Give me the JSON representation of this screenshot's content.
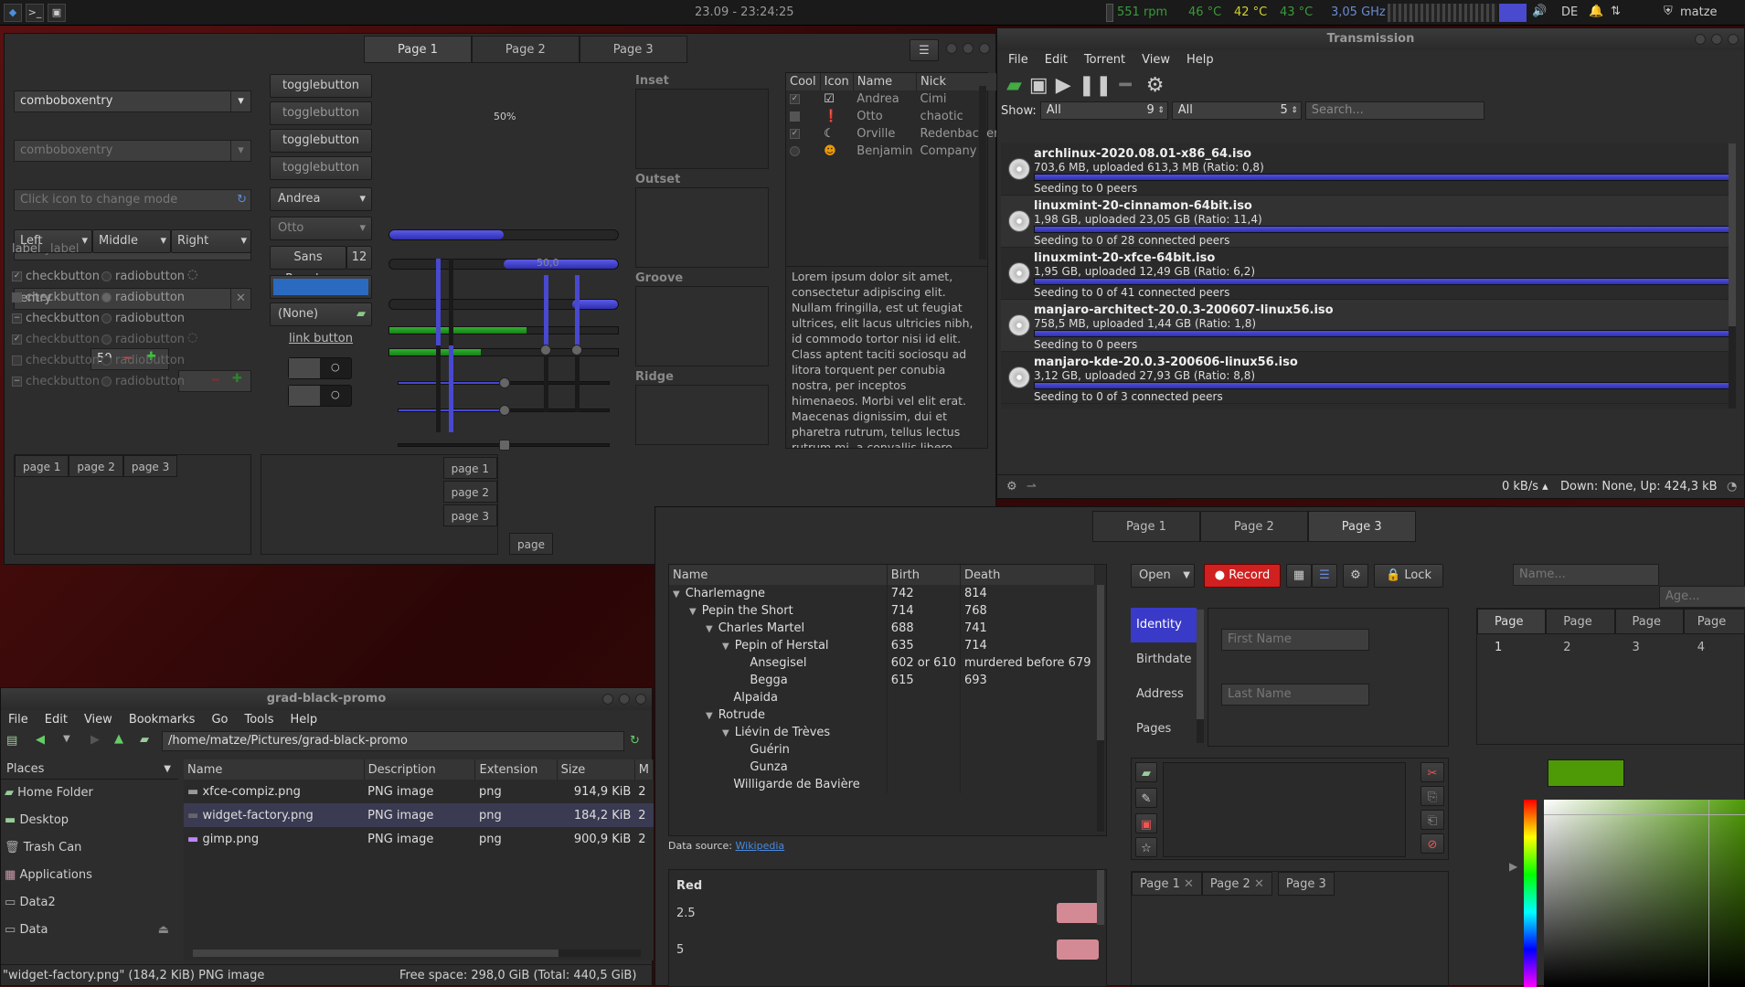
{
  "topbar": {
    "datetime": "23.09 - 23:24:25",
    "rpm": "551 rpm",
    "t1": "46 °C",
    "t2": "42 °C",
    "t3": "43 °C",
    "ghz": "3,05 GHz",
    "lang": "DE",
    "user": "matze"
  },
  "main": {
    "tabs": [
      "Page 1",
      "Page 2",
      "Page 3"
    ],
    "combo1": "comboboxentry",
    "combo2": "comboboxentry",
    "iconentry": "Click icon to change mode",
    "entry1": "entry",
    "entry2": "entry",
    "lmr": [
      "Left",
      "Middle",
      "Right"
    ],
    "label1": "label",
    "label2": "label",
    "spin": "50",
    "checks": [
      "checkbutton",
      "checkbutton",
      "checkbutton",
      "checkbutton",
      "checkbutton",
      "checkbutton"
    ],
    "radios": [
      "radiobutton",
      "radiobutton",
      "radiobutton",
      "radiobutton",
      "radiobutton",
      "radiobutton"
    ],
    "toggles": [
      "togglebutton",
      "togglebutton",
      "togglebutton",
      "togglebutton"
    ],
    "combo_andrea": "Andrea",
    "combo_otto": "Otto",
    "font": "Sans Regular",
    "fontsize": "12",
    "none": "(None)",
    "link": "link button",
    "pct": "50%",
    "vscale": "50,0",
    "frames": [
      "Inset",
      "Outset",
      "Groove",
      "Ridge"
    ],
    "tree_headers": [
      "Cool",
      "Icon",
      "Name",
      "Nick"
    ],
    "tree_rows": [
      {
        "name": "Andrea",
        "nick": "Cimi"
      },
      {
        "name": "Otto",
        "nick": "chaotic"
      },
      {
        "name": "Orville",
        "nick": "Redenbacher"
      },
      {
        "name": "Benjamin",
        "nick": "Company"
      }
    ],
    "lorem": "Lorem ipsum dolor sit amet, consectetur adipiscing elit. Nullam fringilla, est ut feugiat ultrices, elit lacus ultricies nibh, id commodo tortor nisi id elit. Class aptent taciti sociosqu ad litora torquent per conubia nostra, per inceptos himenaeos. Morbi vel elit erat. Maecenas dignissim, dui et pharetra rutrum, tellus lectus rutrum mi, a convallis libero nisi quis tellus.",
    "small_tabs": [
      "page 1",
      "page 2",
      "page 3"
    ],
    "vtabs": [
      "page 1",
      "page 2",
      "page 3"
    ],
    "cut_tab": "page"
  },
  "transmission": {
    "title": "Transmission",
    "menu": [
      "File",
      "Edit",
      "Torrent",
      "View",
      "Help"
    ],
    "show": "Show:",
    "filter1": "All",
    "count1": "9",
    "filter2": "All",
    "count2": "5",
    "search": "Search...",
    "items": [
      {
        "name": "archlinux-2020.08.01-x86_64.iso",
        "stats": "703,6 MB, uploaded 613,3 MB (Ratio: 0,8)",
        "seed": "Seeding to 0 peers",
        "progress": 1.0
      },
      {
        "name": "linuxmint-20-cinnamon-64bit.iso",
        "stats": "1,98 GB, uploaded 23,05 GB (Ratio: 11,4)",
        "seed": "Seeding to 0 of 28 connected peers",
        "progress": 1.0
      },
      {
        "name": "linuxmint-20-xfce-64bit.iso",
        "stats": "1,95 GB, uploaded 12,49 GB (Ratio: 6,2)",
        "seed": "Seeding to 0 of 41 connected peers",
        "progress": 1.0
      },
      {
        "name": "manjaro-architect-20.0.3-200607-linux56.iso",
        "stats": "758,5 MB, uploaded 1,44 GB (Ratio: 1,8)",
        "seed": "Seeding to 0 peers",
        "progress": 1.0
      },
      {
        "name": "manjaro-kde-20.0.3-200606-linux56.iso",
        "stats": "3,12 GB, uploaded 27,93 GB (Ratio: 8,8)",
        "seed": "Seeding to 0 of 3 connected peers",
        "progress": 1.0
      }
    ],
    "speed": "0 kB/s ▴",
    "status": "Down: None, Up: 424,3 kB"
  },
  "fm": {
    "title": "grad-black-promo",
    "menu": [
      "File",
      "Edit",
      "View",
      "Bookmarks",
      "Go",
      "Tools",
      "Help"
    ],
    "path": "/home/matze/Pictures/grad-black-promo",
    "places": "Places",
    "place_items": [
      "Home Folder",
      "Desktop",
      "Trash Can",
      "Applications",
      "Data2",
      "Data"
    ],
    "cols": [
      "Name",
      "Description",
      "Extension",
      "Size",
      "M"
    ],
    "files": [
      {
        "name": "xfce-compiz.png",
        "desc": "PNG image",
        "ext": "png",
        "size": "914,9 KiB",
        "m": "2"
      },
      {
        "name": "widget-factory.png",
        "desc": "PNG image",
        "ext": "png",
        "size": "184,2 KiB",
        "m": "2"
      },
      {
        "name": "gimp.png",
        "desc": "PNG image",
        "ext": "png",
        "size": "900,9 KiB",
        "m": "2"
      }
    ],
    "status_left": "\"widget-factory.png\" (184,2 KiB) PNG image",
    "status_right": "Free space: 298,0 GiB (Total: 440,5 GiB)"
  },
  "wf2": {
    "tabs": [
      "Page 1",
      "Page 2",
      "Page 3"
    ],
    "cols": [
      "Name",
      "Birth",
      "Death"
    ],
    "rows": [
      {
        "n": "Charlemagne",
        "b": "742",
        "d": "814",
        "lvl": 0
      },
      {
        "n": "Pepin the Short",
        "b": "714",
        "d": "768",
        "lvl": 1
      },
      {
        "n": "Charles Martel",
        "b": "688",
        "d": "741",
        "lvl": 2
      },
      {
        "n": "Pepin of Herstal",
        "b": "635",
        "d": "714",
        "lvl": 3
      },
      {
        "n": "Ansegisel",
        "b": "602 or 610",
        "d": "murdered before 679",
        "lvl": 4
      },
      {
        "n": "Begga",
        "b": "615",
        "d": "693",
        "lvl": 4
      },
      {
        "n": "Alpaida",
        "b": "",
        "d": "",
        "lvl": 3
      },
      {
        "n": "Rotrude",
        "b": "",
        "d": "",
        "lvl": 2
      },
      {
        "n": "Liévin de Trèves",
        "b": "",
        "d": "",
        "lvl": 3
      },
      {
        "n": "Guérin",
        "b": "",
        "d": "",
        "lvl": 4
      },
      {
        "n": "Gunza",
        "b": "",
        "d": "",
        "lvl": 4
      },
      {
        "n": "Willigarde de Bavière",
        "b": "",
        "d": "",
        "lvl": 3
      }
    ],
    "datasource": "Data source:",
    "wiki": "Wikipedia",
    "open": "Open",
    "record": "Record",
    "lock": "Lock",
    "stack": [
      "Identity",
      "Birthdate",
      "Address",
      "Pages"
    ],
    "first": "First Name",
    "last": "Last Name",
    "name_ph": "Name...",
    "age_ph": "Age...",
    "ntabs": [
      "Page 1",
      "Page 2",
      "Page 3",
      "Page 4"
    ],
    "ctabs": [
      "Page 1",
      "Page 2",
      "Page 3"
    ],
    "red": "Red",
    "v1": "2.5",
    "v2": "5",
    "hex": "#4E9A06"
  }
}
